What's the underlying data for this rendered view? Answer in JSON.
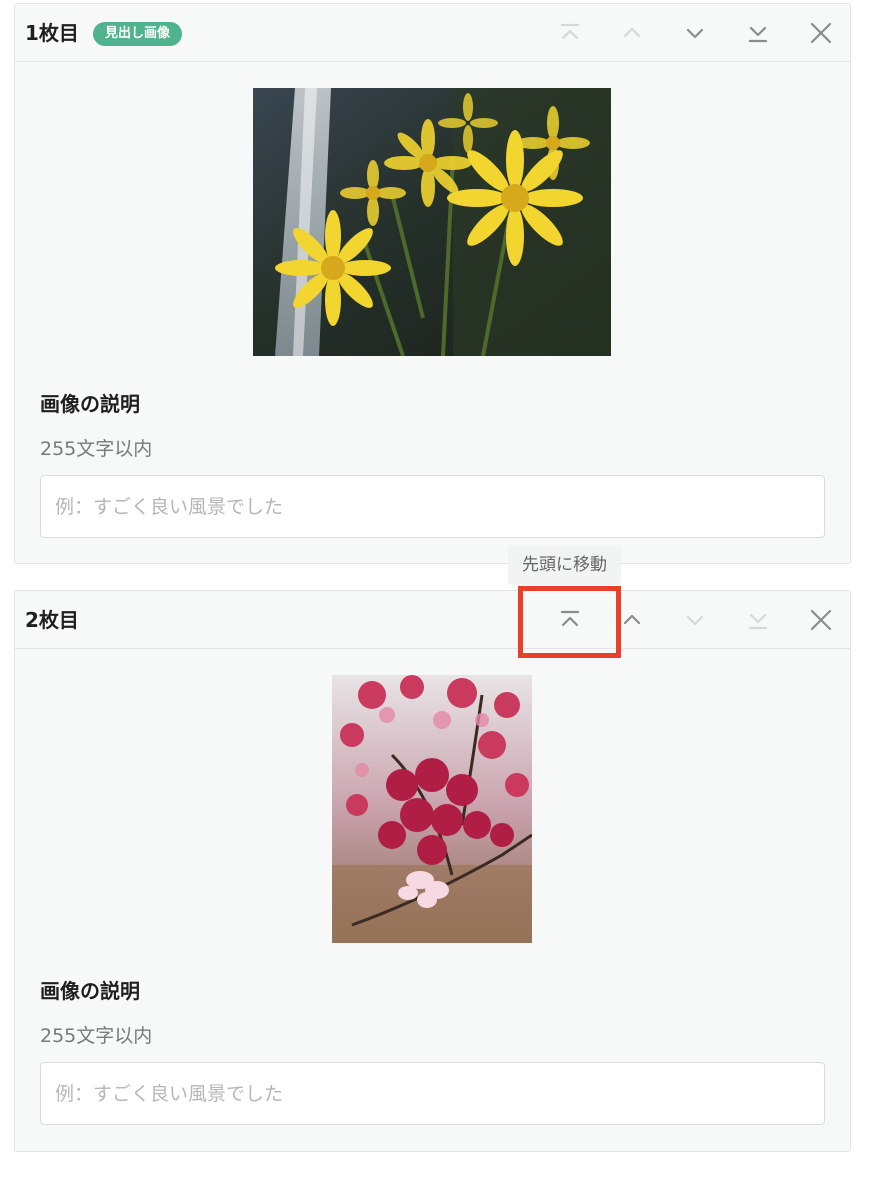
{
  "cards": [
    {
      "title": "1枚目",
      "badge": "見出し画像",
      "controls": {
        "move_top": {
          "icon": "chevron-double-up-icon",
          "enabled": false
        },
        "move_up": {
          "icon": "chevron-up-icon",
          "enabled": false
        },
        "move_down": {
          "icon": "chevron-down-icon",
          "enabled": true
        },
        "move_bottom": {
          "icon": "chevron-double-down-icon",
          "enabled": true
        },
        "remove": {
          "icon": "close-icon",
          "enabled": true
        }
      },
      "image": {
        "subject": "yellow flowers with waterfall"
      },
      "description": {
        "label": "画像の説明",
        "hint": "255文字以内",
        "placeholder": "例：すごく良い風景でした",
        "value": ""
      }
    },
    {
      "title": "2枚目",
      "controls": {
        "move_top": {
          "icon": "chevron-double-up-icon",
          "enabled": true
        },
        "move_up": {
          "icon": "chevron-up-icon",
          "enabled": true
        },
        "move_down": {
          "icon": "chevron-down-icon",
          "enabled": false
        },
        "move_bottom": {
          "icon": "chevron-double-down-icon",
          "enabled": false
        },
        "remove": {
          "icon": "close-icon",
          "enabled": true
        }
      },
      "image": {
        "subject": "pink cherry blossoms"
      },
      "description": {
        "label": "画像の説明",
        "hint": "255文字以内",
        "placeholder": "例：すごく良い風景でした",
        "value": ""
      }
    }
  ],
  "tooltip": {
    "text": "先頭に移動"
  },
  "colors": {
    "badge": "#4fb38d",
    "highlight": "#e8402a",
    "icon_enabled": "#8a8d8f",
    "icon_disabled": "#d6d9da"
  }
}
